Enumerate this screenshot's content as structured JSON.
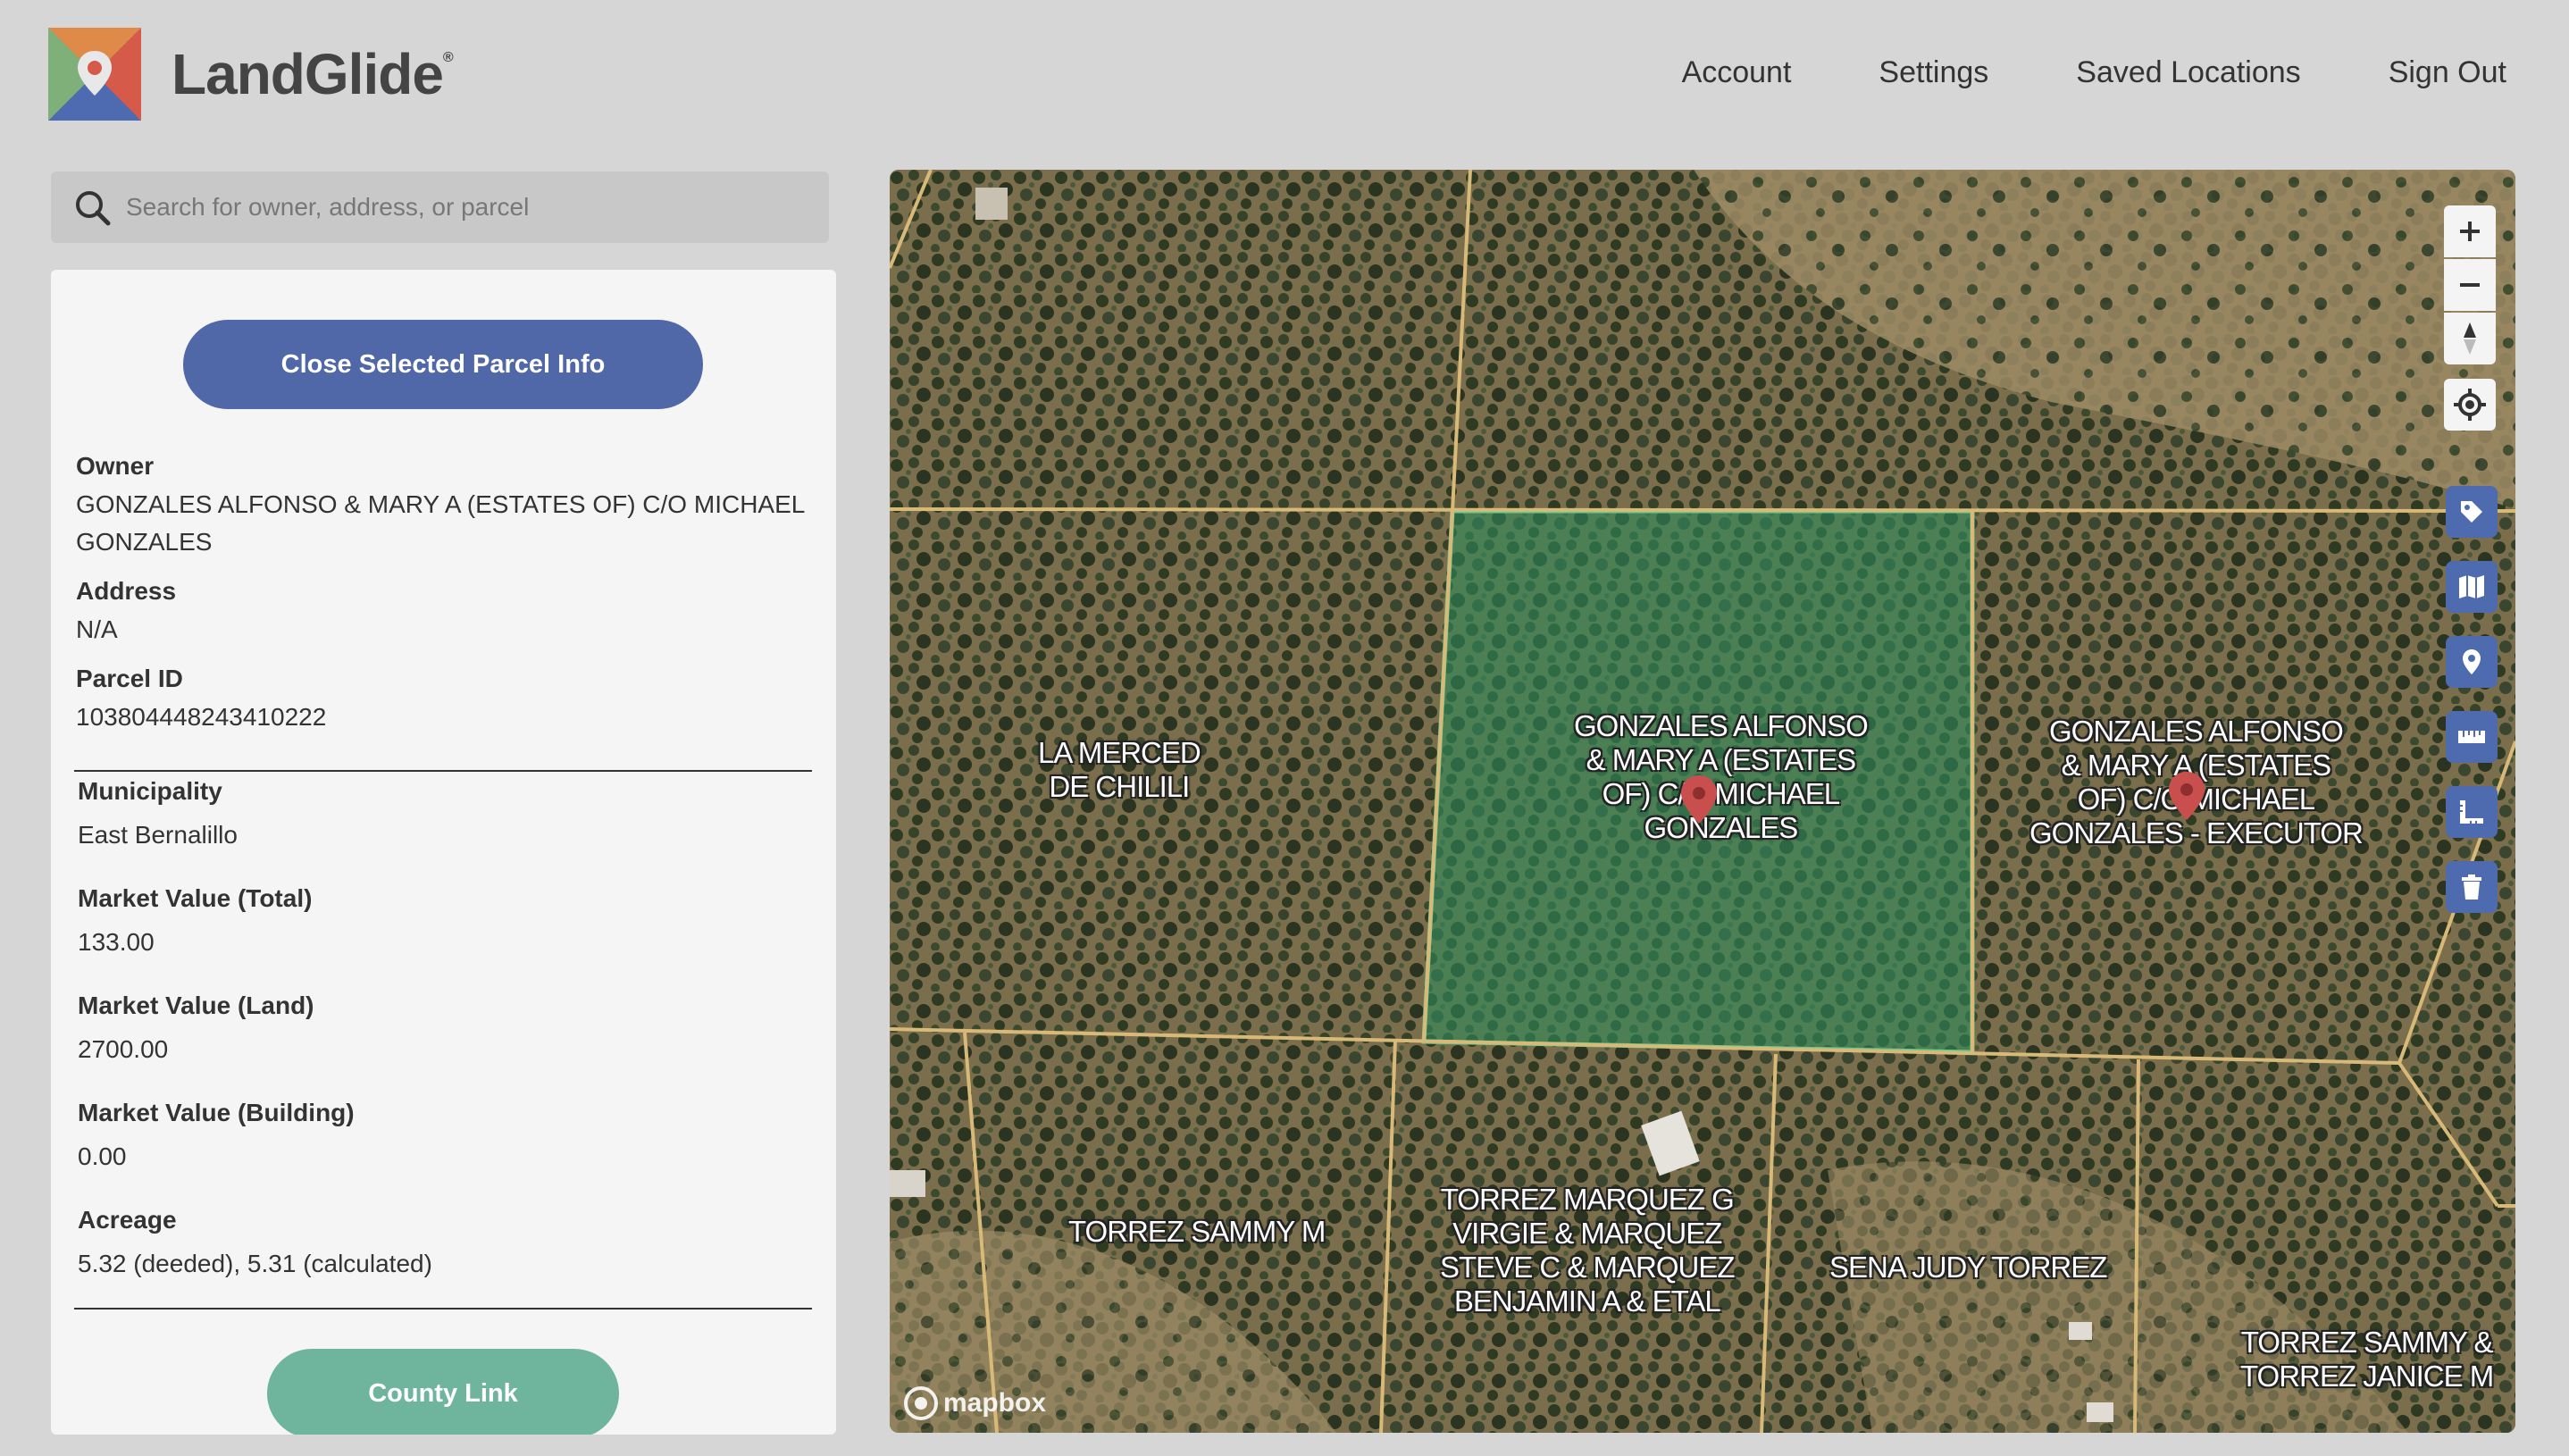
{
  "app": {
    "name": "LandGlide",
    "registered_mark": "®"
  },
  "nav": {
    "items": [
      "Account",
      "Settings",
      "Saved Locations",
      "Sign Out"
    ]
  },
  "search": {
    "placeholder": "Search for owner, address, or parcel",
    "value": ""
  },
  "panel": {
    "close_button": "Close Selected Parcel Info",
    "owner_label": "Owner",
    "owner_value": "GONZALES ALFONSO & MARY A (ESTATES OF) C/O MICHAEL GONZALES",
    "address_label": "Address",
    "address_value": "N/A",
    "parcel_id_label": "Parcel ID",
    "parcel_id_value": "103804448243410222",
    "municipality_label": "Municipality",
    "municipality_value": "East Bernalillo",
    "mv_total_label": "Market Value (Total)",
    "mv_total_value": "133.00",
    "mv_land_label": "Market Value (Land)",
    "mv_land_value": "2700.00",
    "mv_building_label": "Market Value (Building)",
    "mv_building_value": "0.00",
    "acreage_label": "Acreage",
    "acreage_value": "5.32 (deeded), 5.31 (calculated)",
    "county_button": "County Link"
  },
  "map": {
    "attribution": "mapbox",
    "parcels": {
      "la_merced": [
        "LA MERCED",
        "DE CHILILI"
      ],
      "selected": [
        "GONZALES ALFONSO",
        "& MARY A (ESTATES",
        "OF) C/O MICHAEL",
        "GONZALES"
      ],
      "east": [
        "GONZALES ALFONSO",
        "& MARY A (ESTATES",
        "OF) C/O MICHAEL",
        "GONZALES - EXECUTOR"
      ],
      "torrez_sammy": [
        "TORREZ SAMMY M"
      ],
      "torrez_marquez": [
        "TORREZ MARQUEZ G",
        "VIRGIE & MARQUEZ",
        "STEVE C & MARQUEZ",
        "BENJAMIN A & ETAL"
      ],
      "sena": [
        "SENA JUDY TORREZ"
      ],
      "torrez_janice": [
        "TORREZ SAMMY &",
        "TORREZ JANICE M"
      ]
    },
    "selected_fill": "#2e8a5c",
    "boundary_color": "#d8b978"
  },
  "colors": {
    "accent": "#5068a8",
    "county": "#6fb59d",
    "control_blue": "#4f6bb0"
  },
  "icons": [
    "search-icon",
    "zoom-in-icon",
    "zoom-out-icon",
    "compass-icon",
    "locate-icon",
    "tag-icon",
    "map-layers-icon",
    "pin-icon",
    "ruler-icon",
    "area-measure-icon",
    "trash-icon",
    "mapbox-logo-icon",
    "location-marker-icon"
  ]
}
